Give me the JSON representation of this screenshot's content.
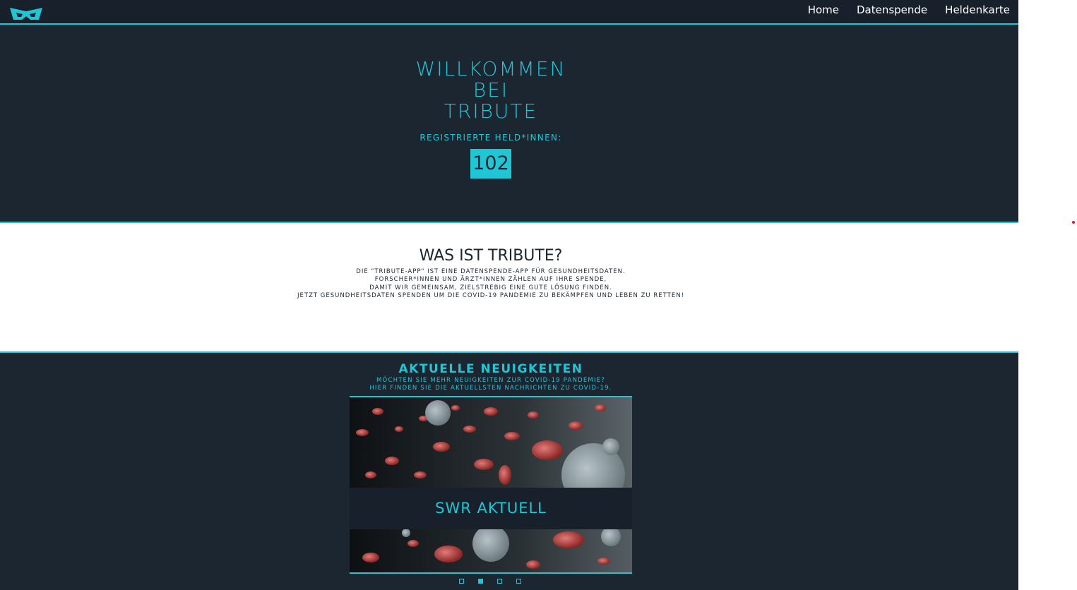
{
  "nav": {
    "logo_icon": "mask-icon",
    "links": [
      "Home",
      "Datenspende",
      "Heldenkarte"
    ]
  },
  "hero": {
    "title_lines": [
      "WILLKOMMEN",
      "BEI",
      "TRIBUTE"
    ],
    "subtitle": "REGISTRIERTE HELD*INNEN:",
    "count": "102"
  },
  "about": {
    "title": "WAS IST TRIBUTE?",
    "lines": [
      "DIE \"TRIBUTE-APP\" IST EINE DATENSPENDE-APP FÜR GESUNDHEITSDATEN.",
      "FORSCHER*INNEN UND ÄRZT*INNEN ZÄHLEN AUF IHRE SPENDE,",
      "DAMIT WIR GEMEINSAM, ZIELSTREBIG EINE GUTE LÖSUNG FINDEN.",
      "JETZT GESUNDHEITSDATEN SPENDEN UM DIE COVID-19 PANDEMIE ZU BEKÄMPFEN UND LEBEN ZU RETTEN!"
    ]
  },
  "news": {
    "title": "AKTUELLE NEUIGKEITEN",
    "sub_lines": [
      "MÖCHTEN SIE MEHR NEUIGKEITEN ZUR COVID-19 PANDEMIE?",
      "HIER FINDEN SIE DIE AKTUELLSTEN NACHRICHTEN ZU COVID-19."
    ],
    "slide_caption": "SWR AKTUELL",
    "active_slide": 2,
    "slide_count": 4
  },
  "colors": {
    "accent": "#1fc7d6",
    "background": "#1c2631",
    "navbar": "#18212b"
  }
}
